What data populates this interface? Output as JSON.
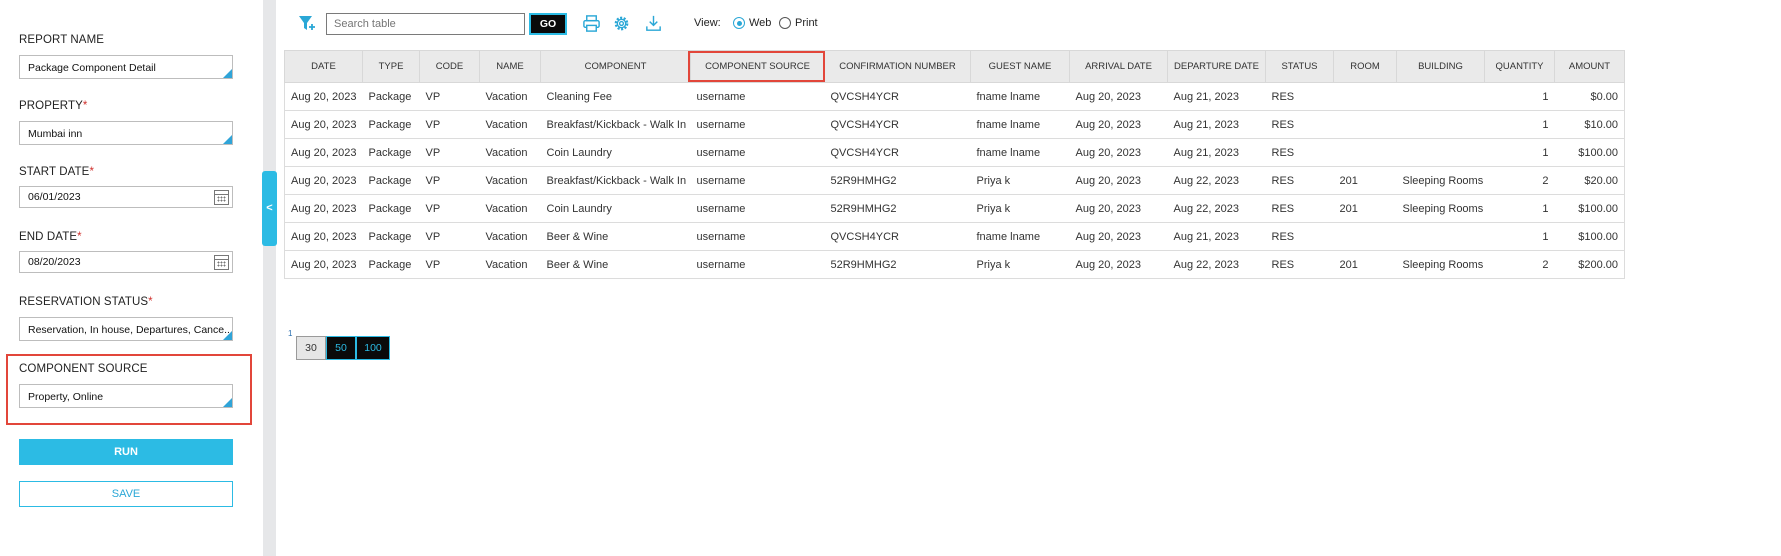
{
  "left_panel": {
    "report_name": {
      "label": "REPORT NAME",
      "value": "Package Component Detail"
    },
    "property": {
      "label": "PROPERTY",
      "required": "*",
      "value": "Mumbai inn"
    },
    "start_date": {
      "label": "START DATE",
      "required": "*",
      "value": "06/01/2023"
    },
    "end_date": {
      "label": "END DATE",
      "required": "*",
      "value": "08/20/2023"
    },
    "reservation_status": {
      "label": "RESERVATION STATUS",
      "required": "*",
      "value": "Reservation, In house, Departures, Cance..."
    },
    "component_source": {
      "label": "COMPONENT SOURCE",
      "value": "Property, Online"
    },
    "run_label": "RUN",
    "save_label": "SAVE",
    "collapse_glyph": "<"
  },
  "toolbar": {
    "search_placeholder": "Search table",
    "go_label": "GO",
    "view_label": "View:",
    "view_options": [
      {
        "label": "Web",
        "selected": true
      },
      {
        "label": "Print",
        "selected": false
      }
    ]
  },
  "table": {
    "headers": [
      "DATE",
      "TYPE",
      "CODE",
      "NAME",
      "COMPONENT",
      "COMPONENT SOURCE",
      "CONFIRMATION NUMBER",
      "GUEST NAME",
      "ARRIVAL DATE",
      "DEPARTURE DATE",
      "STATUS",
      "ROOM",
      "BUILDING",
      "QUANTITY",
      "AMOUNT"
    ],
    "rows": [
      [
        "Aug 20, 2023",
        "Package",
        "VP",
        "Vacation",
        "Cleaning Fee",
        "username",
        "QVCSH4YCR",
        "fname lname",
        "Aug 20, 2023",
        "Aug 21, 2023",
        "RES",
        "",
        "",
        "1",
        "$0.00"
      ],
      [
        "Aug 20, 2023",
        "Package",
        "VP",
        "Vacation",
        "Breakfast/Kickback - Walk In",
        "username",
        "QVCSH4YCR",
        "fname lname",
        "Aug 20, 2023",
        "Aug 21, 2023",
        "RES",
        "",
        "",
        "1",
        "$10.00"
      ],
      [
        "Aug 20, 2023",
        "Package",
        "VP",
        "Vacation",
        "Coin Laundry",
        "username",
        "QVCSH4YCR",
        "fname lname",
        "Aug 20, 2023",
        "Aug 21, 2023",
        "RES",
        "",
        "",
        "1",
        "$100.00"
      ],
      [
        "Aug 20, 2023",
        "Package",
        "VP",
        "Vacation",
        "Breakfast/Kickback - Walk In",
        "username",
        "52R9HMHG2",
        "Priya k",
        "Aug 20, 2023",
        "Aug 22, 2023",
        "RES",
        "201",
        "Sleeping Rooms",
        "2",
        "$20.00"
      ],
      [
        "Aug 20, 2023",
        "Package",
        "VP",
        "Vacation",
        "Coin Laundry",
        "username",
        "52R9HMHG2",
        "Priya k",
        "Aug 20, 2023",
        "Aug 22, 2023",
        "RES",
        "201",
        "Sleeping Rooms",
        "1",
        "$100.00"
      ],
      [
        "Aug 20, 2023",
        "Package",
        "VP",
        "Vacation",
        "Beer & Wine",
        "username",
        "QVCSH4YCR",
        "fname lname",
        "Aug 20, 2023",
        "Aug 21, 2023",
        "RES",
        "",
        "",
        "1",
        "$100.00"
      ],
      [
        "Aug 20, 2023",
        "Package",
        "VP",
        "Vacation",
        "Beer & Wine",
        "username",
        "52R9HMHG2",
        "Priya k",
        "Aug 20, 2023",
        "Aug 22, 2023",
        "RES",
        "201",
        "Sleeping Rooms",
        "2",
        "$200.00"
      ]
    ]
  },
  "pagination": {
    "current_page": "1",
    "page_sizes": [
      "30",
      "50",
      "100"
    ]
  },
  "colors": {
    "accent": "#2cbbe4",
    "highlight": "#e2463a",
    "header_bg": "#eaeaea"
  },
  "icons": [
    "filter-icon",
    "print-icon",
    "settings-icon",
    "download-icon",
    "calendar-icon"
  ]
}
